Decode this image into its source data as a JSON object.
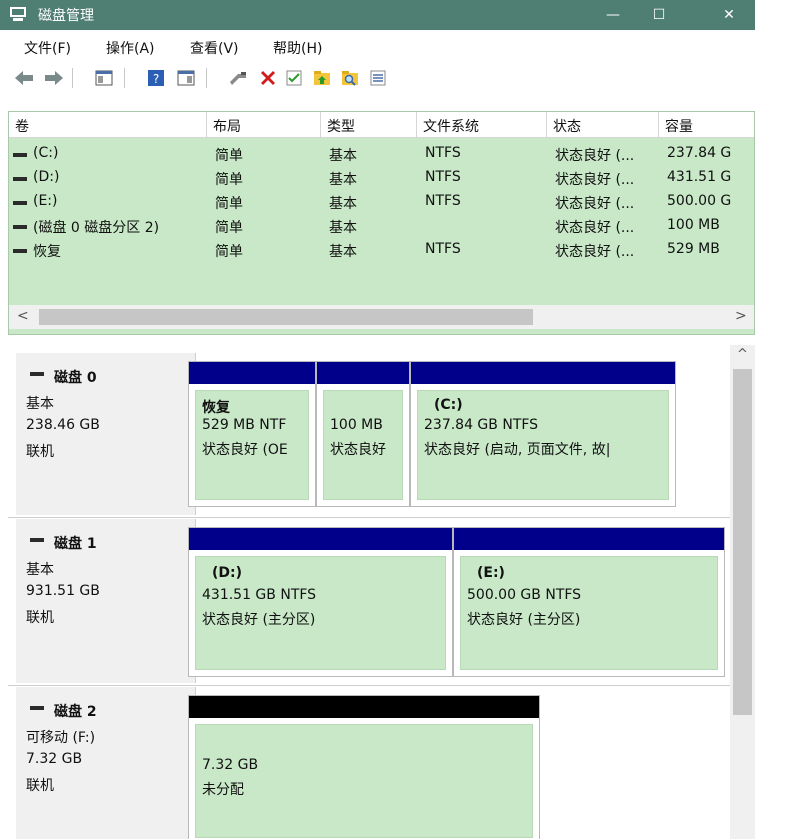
{
  "window": {
    "title": "磁盘管理",
    "minimize": "—",
    "maximize": "☐",
    "close": "✕"
  },
  "menu": [
    "文件(F)",
    "操作(A)",
    "查看(V)",
    "帮助(H)"
  ],
  "list": {
    "columns": [
      "卷",
      "布局",
      "类型",
      "文件系统",
      "状态",
      "容量"
    ],
    "rows": [
      [
        "(C:)",
        "简单",
        "基本",
        "NTFS",
        "状态良好 (...",
        "237.84 G"
      ],
      [
        "(D:)",
        "简单",
        "基本",
        "NTFS",
        "状态良好 (...",
        "431.51 G"
      ],
      [
        "(E:)",
        "简单",
        "基本",
        "NTFS",
        "状态良好 (...",
        "500.00 G"
      ],
      [
        "(磁盘 0 磁盘分区 2)",
        "简单",
        "基本",
        "",
        "状态良好 (...",
        "100 MB"
      ],
      [
        "恢复",
        "简单",
        "基本",
        "NTFS",
        "状态良好 (...",
        "529 MB"
      ]
    ],
    "scroll_left": "<",
    "scroll_right": ">"
  },
  "disks": [
    {
      "name": "磁盘 0",
      "type": "基本",
      "size": "238.46 GB",
      "status": "联机",
      "partitions": [
        {
          "title": "恢复",
          "line1": "529 MB NTF",
          "line2": "状态良好 (OE"
        },
        {
          "title": "",
          "line1": "100 MB",
          "line2": "状态良好"
        },
        {
          "title": "(C:)",
          "line1": "237.84 GB NTFS",
          "line2": "状态良好 (启动, 页面文件, 故|"
        }
      ]
    },
    {
      "name": "磁盘 1",
      "type": "基本",
      "size": "931.51 GB",
      "status": "联机",
      "partitions": [
        {
          "title": "(D:)",
          "line1": "431.51 GB NTFS",
          "line2": "状态良好 (主分区)"
        },
        {
          "title": "(E:)",
          "line1": "500.00 GB NTFS",
          "line2": "状态良好 (主分区)"
        }
      ]
    },
    {
      "name": "磁盘 2",
      "type": "可移动 (F:)",
      "size": "7.32 GB",
      "status": "联机",
      "partitions": [
        {
          "title": "",
          "line1": "7.32 GB",
          "line2": "未分配"
        }
      ]
    }
  ],
  "vscroll_up": "^",
  "colors": {
    "titlebar": "#4f7e73",
    "primary_bar": "#00008b",
    "unallocated_bar": "#000000",
    "volume_fill": "#c8e8c8"
  }
}
